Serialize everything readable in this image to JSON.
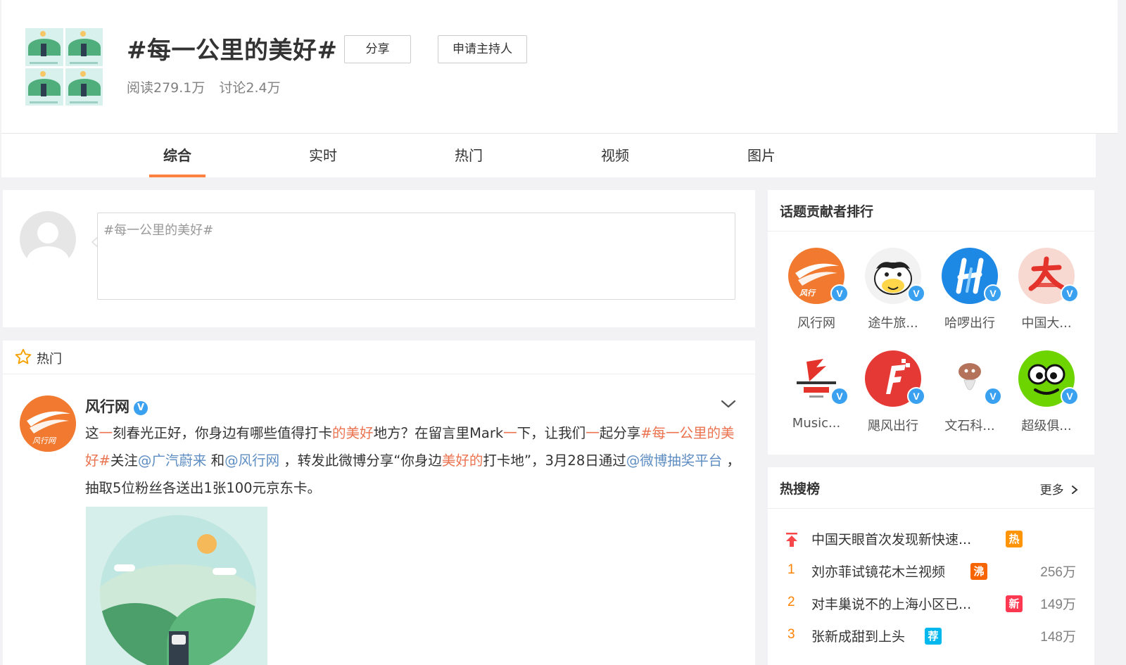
{
  "header": {
    "title": "#每一公里的美好#",
    "share_label": "分享",
    "host_label": "申请主持人",
    "reads": "阅读279.1万",
    "discussions": "讨论2.4万"
  },
  "tabs": [
    {
      "label": "综合",
      "active": true
    },
    {
      "label": "实时",
      "active": false
    },
    {
      "label": "热门",
      "active": false
    },
    {
      "label": "视频",
      "active": false
    },
    {
      "label": "图片",
      "active": false
    }
  ],
  "composer": {
    "value": "#每一公里的美好#"
  },
  "feed": {
    "section_label": "热门",
    "post": {
      "author": "风行网",
      "verified_mark": "V",
      "text_parts": [
        {
          "t": "这",
          "c": ""
        },
        {
          "t": "一",
          "c": "hl"
        },
        {
          "t": "刻春光正好，你身边有哪些值得打卡",
          "c": ""
        },
        {
          "t": "的美好",
          "c": "hl"
        },
        {
          "t": "地方？在留言里Mark",
          "c": ""
        },
        {
          "t": "一",
          "c": "hl"
        },
        {
          "t": "下，让我们",
          "c": ""
        },
        {
          "t": "一",
          "c": "hl"
        },
        {
          "t": "起分享",
          "c": ""
        },
        {
          "t": "#每一公里的美好#",
          "c": "hl"
        },
        {
          "t": "关注",
          "c": ""
        },
        {
          "t": "@广汽蔚来",
          "c": "lk"
        },
        {
          "t": " 和",
          "c": ""
        },
        {
          "t": "@风行网",
          "c": "lk"
        },
        {
          "t": " ，转发此微博分享“你身边",
          "c": ""
        },
        {
          "t": "美好的",
          "c": "hl"
        },
        {
          "t": "打卡地”，3月28日通过",
          "c": ""
        },
        {
          "t": "@微博抽奖平台",
          "c": "lk"
        },
        {
          "t": " ，抽取5位粉丝各送出1张100元京东卡。",
          "c": ""
        }
      ]
    }
  },
  "contributors": {
    "title": "话题贡献者排行",
    "items": [
      {
        "name": "风行网",
        "icon": "fengxing-logo",
        "color": "#f17a30"
      },
      {
        "name": "途牛旅...",
        "icon": "tuniu-cow-logo",
        "color": "#ffd54a"
      },
      {
        "name": "哈啰出行",
        "icon": "hello-logo",
        "color": "#1e88e5"
      },
      {
        "name": "中国大...",
        "icon": "china-univ-logo",
        "color": "#f8d9d2"
      },
      {
        "name": "Music...",
        "icon": "music-logo",
        "color": "#ffffff"
      },
      {
        "name": "飓风出行",
        "icon": "jufeng-logo",
        "color": "#e53935"
      },
      {
        "name": "文石科...",
        "icon": "wenshi-logo",
        "color": "#ffffff"
      },
      {
        "name": "超级俱...",
        "icon": "frog-logo",
        "color": "#6dd400"
      }
    ]
  },
  "hot_search": {
    "title": "热搜榜",
    "more_label": "更多",
    "items": [
      {
        "rank": "",
        "title": "中国天眼首次发现新快速...",
        "tag": "热",
        "tag_color": "#ff9406",
        "count": ""
      },
      {
        "rank": "1",
        "title": "刘亦菲试镜花木兰视频",
        "tag": "沸",
        "tag_color": "#f86400",
        "count": "256万"
      },
      {
        "rank": "2",
        "title": "对丰巢说不的上海小区已...",
        "tag": "新",
        "tag_color": "#ff3852",
        "count": "149万"
      },
      {
        "rank": "3",
        "title": "张新成甜到上头",
        "tag": "荐",
        "tag_color": "#00b7ee",
        "count": "148万"
      }
    ]
  }
}
